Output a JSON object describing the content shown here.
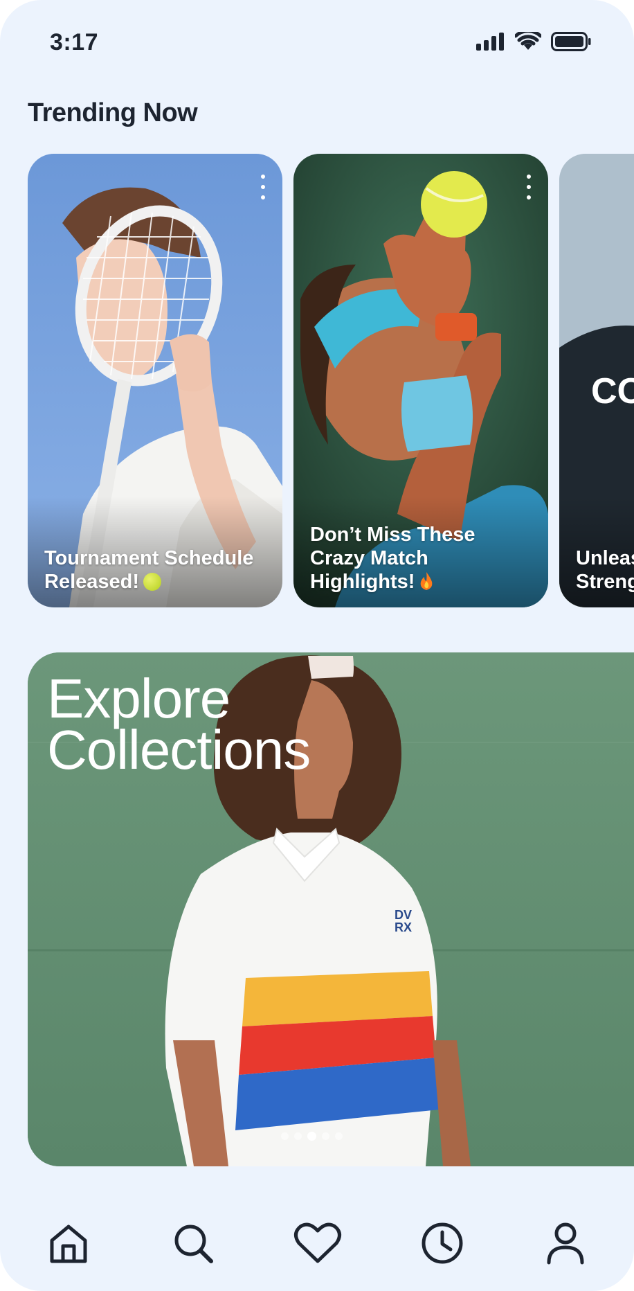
{
  "status_bar": {
    "time": "3:17"
  },
  "trending": {
    "title": "Trending Now",
    "cards": [
      {
        "caption": "Tournament Schedule Released!",
        "emoji": "tennis-ball-icon"
      },
      {
        "caption": "Don’t Miss These Crazy Match Highlights!",
        "emoji": "fire-icon"
      },
      {
        "caption": "Unleas Streng"
      }
    ]
  },
  "collections": {
    "title_line1": "Explore",
    "title_line2": "Collections",
    "dots_count": 5,
    "active_dot": 3
  },
  "bottom_nav": {
    "items": [
      "home-icon",
      "search-icon",
      "heart-icon",
      "history-icon",
      "profile-icon"
    ]
  },
  "colors": {
    "background": "#ecf3fd",
    "text_dark": "#1d2430",
    "nav_icon": "#1d2430"
  }
}
